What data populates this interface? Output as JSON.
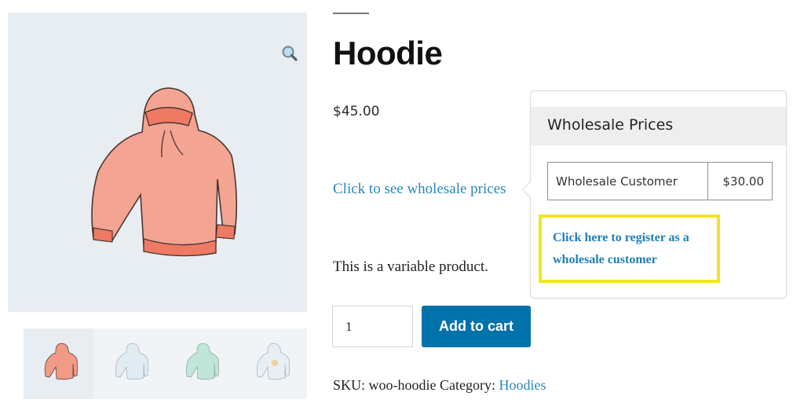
{
  "product": {
    "title": "Hoodie",
    "price": "$45.00",
    "wholesale_link": "Click to see wholesale prices",
    "description": "This is a variable product.",
    "quantity": "1",
    "add_to_cart_label": "Add to cart",
    "sku_label": "SKU:",
    "sku_value": "woo-hoodie",
    "category_label": "Category:",
    "category_value": "Hoodies"
  },
  "gallery": {
    "zoom_icon": "magnifier-icon",
    "thumbnails": [
      {
        "name": "hoodie-red",
        "color": "#f19a86",
        "active": true
      },
      {
        "name": "hoodie-light-blue",
        "color": "#dde9f0",
        "active": false
      },
      {
        "name": "hoodie-green",
        "color": "#b8e3d4",
        "active": false
      },
      {
        "name": "hoodie-logo",
        "color": "#e4ecf2",
        "active": false
      }
    ]
  },
  "wholesale_popup": {
    "title": "Wholesale Prices",
    "rows": [
      {
        "role": "Wholesale Customer",
        "price": "$30.00"
      }
    ],
    "register_link": "Click here to register as a wholesale customer",
    "highlight_color": "#f2e51d"
  },
  "colors": {
    "accent": "#0073aa",
    "link": "#2a87b8"
  }
}
